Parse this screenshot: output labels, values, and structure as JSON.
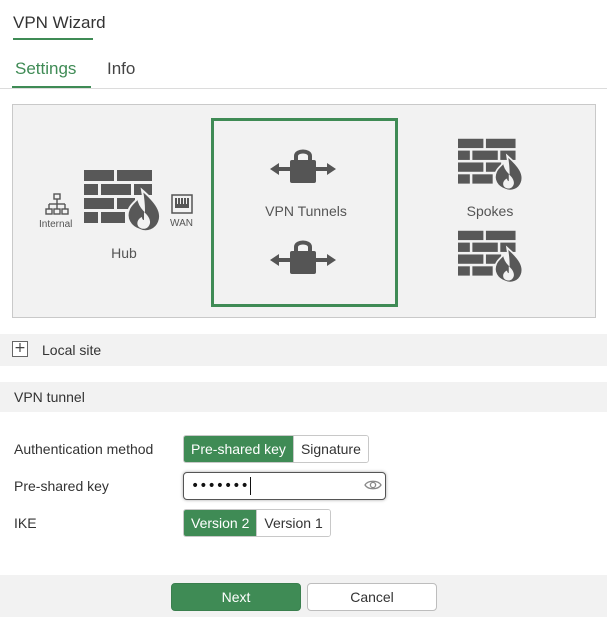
{
  "window": {
    "title": "VPN Wizard"
  },
  "tabs": [
    {
      "label": "Settings",
      "active": true
    },
    {
      "label": "Info",
      "active": false
    }
  ],
  "diagram": {
    "internal_label": "Internal",
    "wan_label": "WAN",
    "hub_label": "Hub",
    "tunnels_label": "VPN Tunnels",
    "spokes_label": "Spokes"
  },
  "sections": {
    "local_site": "Local site",
    "vpn_tunnel": "VPN tunnel"
  },
  "form": {
    "auth_method_label": "Authentication method",
    "auth_options": [
      {
        "label": "Pre-shared key",
        "active": true
      },
      {
        "label": "Signature",
        "active": false
      }
    ],
    "psk_label": "Pre-shared key",
    "psk_value": "•••••••",
    "ike_label": "IKE",
    "ike_options": [
      {
        "label": "Version 2",
        "active": true
      },
      {
        "label": "Version 1",
        "active": false
      }
    ]
  },
  "buttons": {
    "next": "Next",
    "cancel": "Cancel"
  },
  "colors": {
    "accent": "#3f8b55",
    "icon": "#555555",
    "panel": "#f2f2f2"
  },
  "icons": [
    "firewall-icon",
    "lock-arrows-icon",
    "network-icon",
    "wan-port-icon",
    "eye-icon",
    "plus-icon"
  ]
}
